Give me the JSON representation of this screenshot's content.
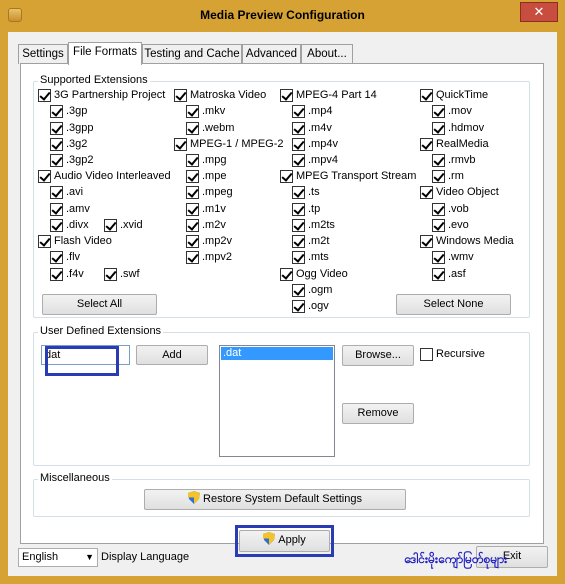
{
  "window": {
    "title": "Media Preview Configuration",
    "close_glyph": "✕"
  },
  "tabs": [
    "Settings",
    "File Formats",
    "Testing and Cache",
    "Advanced",
    "About..."
  ],
  "supported": {
    "label": "Supported Extensions",
    "groups": [
      {
        "name": "3G Partnership Project",
        "checked": true,
        "items": [
          ".3gp",
          ".3gpp",
          ".3g2",
          ".3gp2"
        ]
      },
      {
        "name": "Audio Video Interleaved",
        "checked": true,
        "items": [
          ".avi",
          ".amv",
          ".divx",
          ".xvid"
        ]
      },
      {
        "name": "Flash Video",
        "checked": true,
        "items": [
          ".flv",
          ".f4v",
          ".swf"
        ]
      },
      {
        "name": "Matroska Video",
        "checked": true,
        "items": [
          ".mkv",
          ".webm"
        ]
      },
      {
        "name": "MPEG-1 / MPEG-2",
        "checked": true,
        "items": [
          ".mpg",
          ".mpe",
          ".mpeg",
          ".m1v",
          ".m2v",
          ".mp2v",
          ".mpv2"
        ]
      },
      {
        "name": "MPEG-4 Part 14",
        "checked": true,
        "items": [
          ".mp4",
          ".m4v",
          ".mp4v",
          ".mpv4"
        ]
      },
      {
        "name": "MPEG Transport Stream",
        "checked": true,
        "items": [
          ".ts",
          ".tp",
          ".m2ts",
          ".m2t",
          ".mts"
        ]
      },
      {
        "name": "Ogg Video",
        "checked": true,
        "items": [
          ".ogm",
          ".ogv"
        ]
      },
      {
        "name": "QuickTime",
        "checked": true,
        "items": [
          ".mov",
          ".hdmov"
        ]
      },
      {
        "name": "RealMedia",
        "checked": true,
        "items": [
          ".rmvb",
          ".rm"
        ]
      },
      {
        "name": "Video Object",
        "checked": true,
        "items": [
          ".vob",
          ".evo"
        ]
      },
      {
        "name": "Windows Media",
        "checked": true,
        "items": [
          ".wmv",
          ".asf"
        ]
      }
    ],
    "select_all": "Select All",
    "select_none": "Select None"
  },
  "user_defined": {
    "label": "User Defined Extensions",
    "input_value": "dat",
    "add": "Add",
    "list": [
      ".dat"
    ],
    "browse": "Browse...",
    "recursive": "Recursive",
    "remove": "Remove"
  },
  "misc": {
    "label": "Miscellaneous",
    "restore": "Restore System Default Settings"
  },
  "apply": "Apply",
  "language": {
    "value": "English",
    "label": "Display Language"
  },
  "exit": "Exit",
  "watermark": "ဒေါင်းမိုးကျော်မြတ်စုများ",
  "colors": {
    "frame": "#d7a234",
    "highlight": "#2a3cb3",
    "selection": "#3399ff"
  }
}
